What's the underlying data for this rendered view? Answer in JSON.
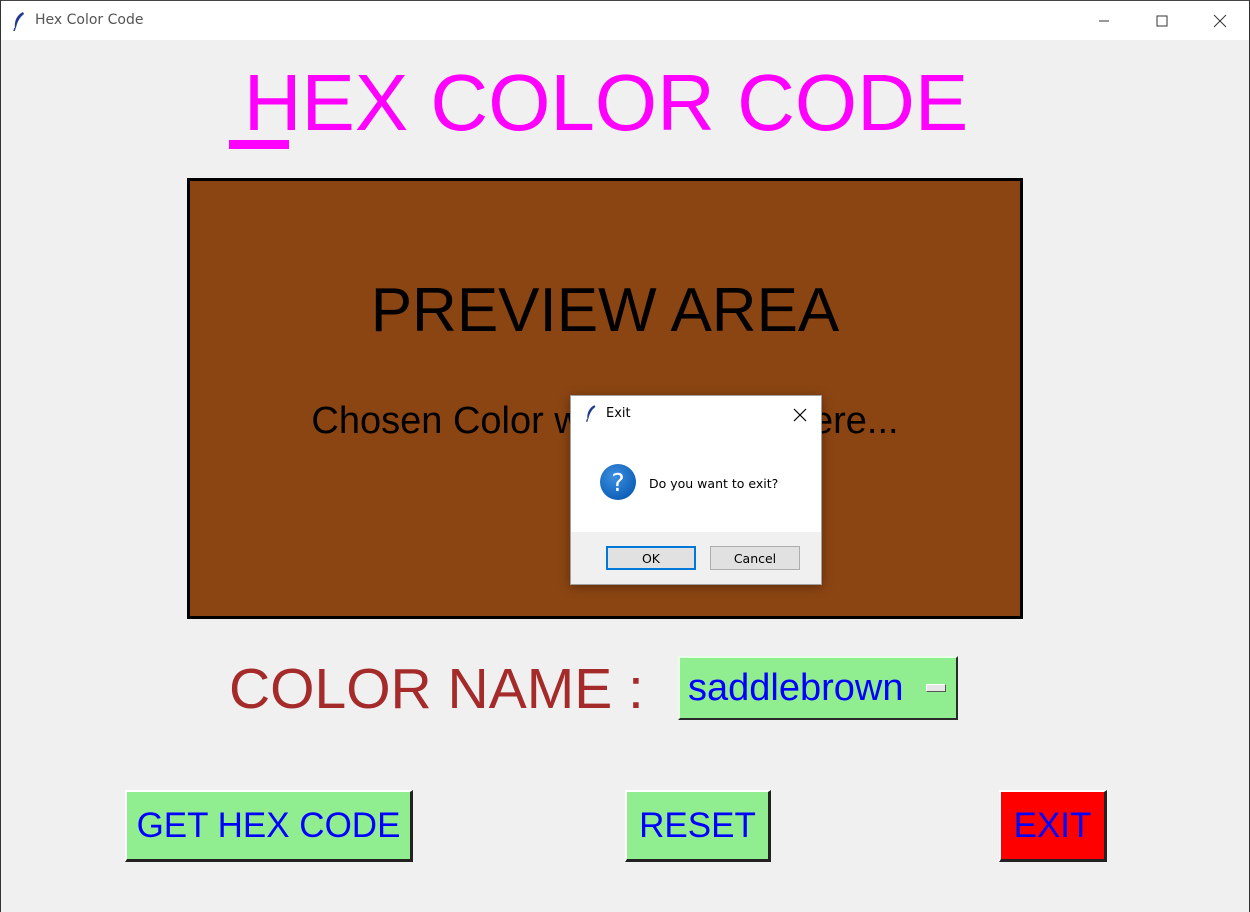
{
  "window": {
    "title": "Hex Color Code"
  },
  "header": {
    "first_letter": "H",
    "rest": "EX COLOR CODE"
  },
  "preview": {
    "title": "PREVIEW AREA",
    "subtitle": "Chosen Color will be shown here...",
    "background_color": "#8b4513"
  },
  "color_picker": {
    "label": "COLOR NAME :",
    "selected": "saddlebrown"
  },
  "buttons": {
    "get_hex": "GET HEX CODE",
    "reset": "RESET",
    "exit": "EXIT"
  },
  "dialog": {
    "title": "Exit",
    "message": "Do you want to exit?",
    "ok_label": "OK",
    "cancel_label": "Cancel",
    "icon": "question-icon"
  },
  "colors": {
    "heading": "#ff00ff",
    "label": "#a52a2a",
    "button_green": "#90ee90",
    "button_red": "#ff0000",
    "button_text": "#0000ff"
  }
}
